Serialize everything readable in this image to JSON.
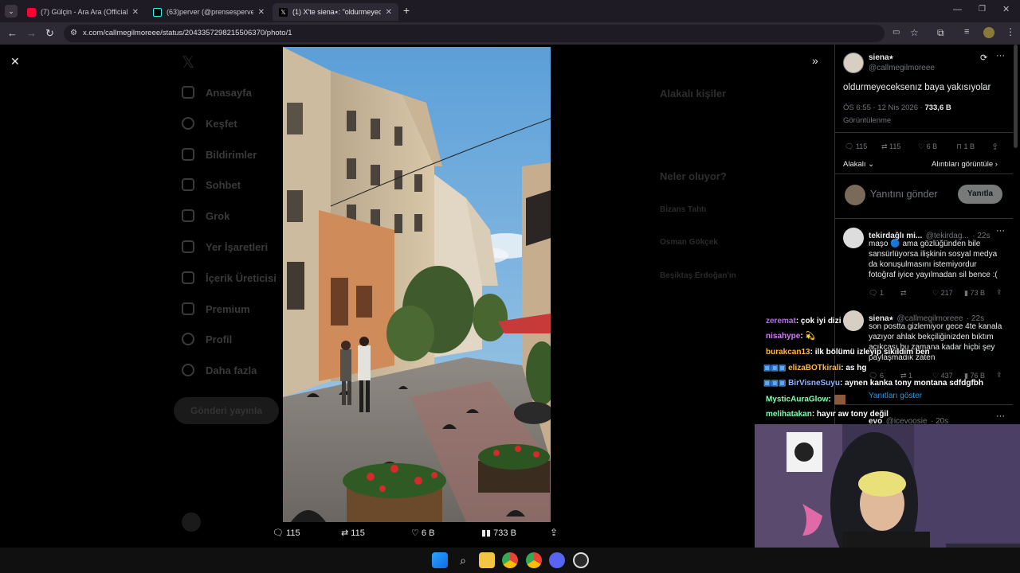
{
  "browser": {
    "tabs": [
      {
        "title": "(7) Gülçin - Ara Ara (Official Vid",
        "fav_color": "#ff0033"
      },
      {
        "title": "(63)perver (@prensesperver) | T",
        "fav_color": "#111111"
      },
      {
        "title": "(1) X'te siena⭑: \"oldurmeyeceks",
        "fav_color": "#111111"
      }
    ],
    "new_tab": "+",
    "url": "x.com/callmegilmoreee/status/2043357298215506370/photo/1"
  },
  "x_sidebar": [
    "Anasayfa",
    "Keşfet",
    "Bildirimler",
    "Sohbet",
    "Grok",
    "Yer İşaretleri",
    "İçerik Üreticisi",
    "Premium",
    "Profil",
    "Daha fazla"
  ],
  "x_post_button": "Gönderi yayınla",
  "background_right": {
    "related_title": "Alakalı kişiler",
    "happening_title": "Neler oluyor?",
    "trend1": "Bizans Tahtı",
    "trend2": "Osman Gökçek",
    "trend3": "Beşiktaş Erdoğan'ın"
  },
  "photo_bar": {
    "replies": "115",
    "reposts": "115",
    "likes": "6 B",
    "views": "733 B"
  },
  "tweet": {
    "name": "siena⭑",
    "handle": "@callmegilmoreee",
    "text": "oldurmeyeceksenız baya yakısıyolar",
    "time": "ÖS 6:55 · 12 Nis 2026 ·",
    "views_count": "733,6 B",
    "views_label": "Görüntülenme",
    "replies": "115",
    "reposts": "115",
    "likes": "6 B",
    "bookmarks": "1 B",
    "related": "Alakalı",
    "quotes_link": "Alıntıları görüntüle",
    "reply_placeholder": "Yanıtını gönder",
    "reply_button": "Yanıtla"
  },
  "replies": [
    {
      "name": "tekirdağlı mi...",
      "handle": "@tekirdag...",
      "time": "· 22s",
      "text": "maşo 🔵 ama gözlüğünden bile sansürlüyorsa ilişkinin sosyal medya da konuşulmasını istemiyordur fotoğraf iyice yayılmadan sil bence :(",
      "replies": "1",
      "likes": "217",
      "views": "73 B"
    },
    {
      "name": "siena⭑",
      "handle": "@callmegilmoreee",
      "time": "· 22s",
      "text": "son postta gizlemiyor gece 4te kanala yazıyor ahlak bekçiliğinizden bıktım açıkçası bu zamana kadar hiçbi şey paylaşmadık zaten",
      "replies": "6",
      "reposts": "1",
      "likes": "437",
      "views": "76 B",
      "show_replies": "Yanıtları göster"
    },
    {
      "name": "evo",
      "handle": "@icevoosie",
      "time": "· 20s"
    }
  ],
  "chat": [
    {
      "user": "zeremat",
      "msg": ": çok iyi dizi",
      "color": "#b86cff"
    },
    {
      "user": "nisahype",
      "msg": ": 💫",
      "color": "#d77bff"
    },
    {
      "user": "burakcan13",
      "msg": ": ilk bölümü izleyip sıkıldım ben",
      "color": "#ffb84d"
    },
    {
      "user": "elizaBOTkirali",
      "msg": ": as hg",
      "color": "#ffb84d"
    },
    {
      "user": "BirVisneSuyu",
      "msg": ": aynen kanka tony montana sdfdgfbh",
      "color": "#8ab4ff"
    },
    {
      "user": "MysticAuraGlow",
      "msg": ":",
      "color": "#7dffb0"
    },
    {
      "user": "melihatakan",
      "msg": ": hayır aw tony değil",
      "color": "#7dffb0"
    }
  ]
}
